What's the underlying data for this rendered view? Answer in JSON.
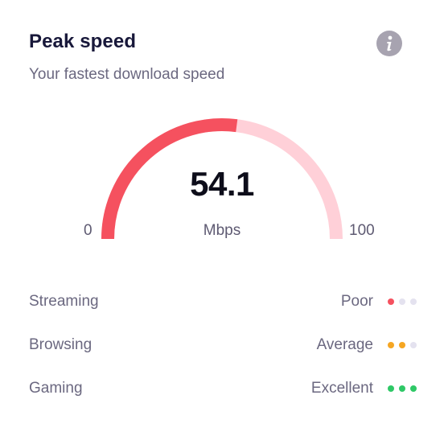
{
  "header": {
    "title": "Peak speed",
    "subtitle": "Your fastest download speed"
  },
  "info": {
    "icon": "info-icon"
  },
  "gauge": {
    "value": "54.1",
    "value_number": 54.1,
    "unit": "Mbps",
    "min": "0",
    "max": "100",
    "min_number": 0,
    "max_number": 100,
    "fill_color": "#f5515f",
    "track_color": "#ffd0d8"
  },
  "ratings": [
    {
      "label": "Streaming",
      "rating": "Poor",
      "filled": 1,
      "color": "#f5515f"
    },
    {
      "label": "Browsing",
      "rating": "Average",
      "filled": 2,
      "color": "#f5a623"
    },
    {
      "label": "Gaming",
      "rating": "Excellent",
      "filled": 3,
      "color": "#2ec866"
    }
  ],
  "colors": {
    "title": "#18183a",
    "muted_text": "#6b6880",
    "empty_dot": "#e4e2ef",
    "info_bg": "#a7a3b0"
  }
}
